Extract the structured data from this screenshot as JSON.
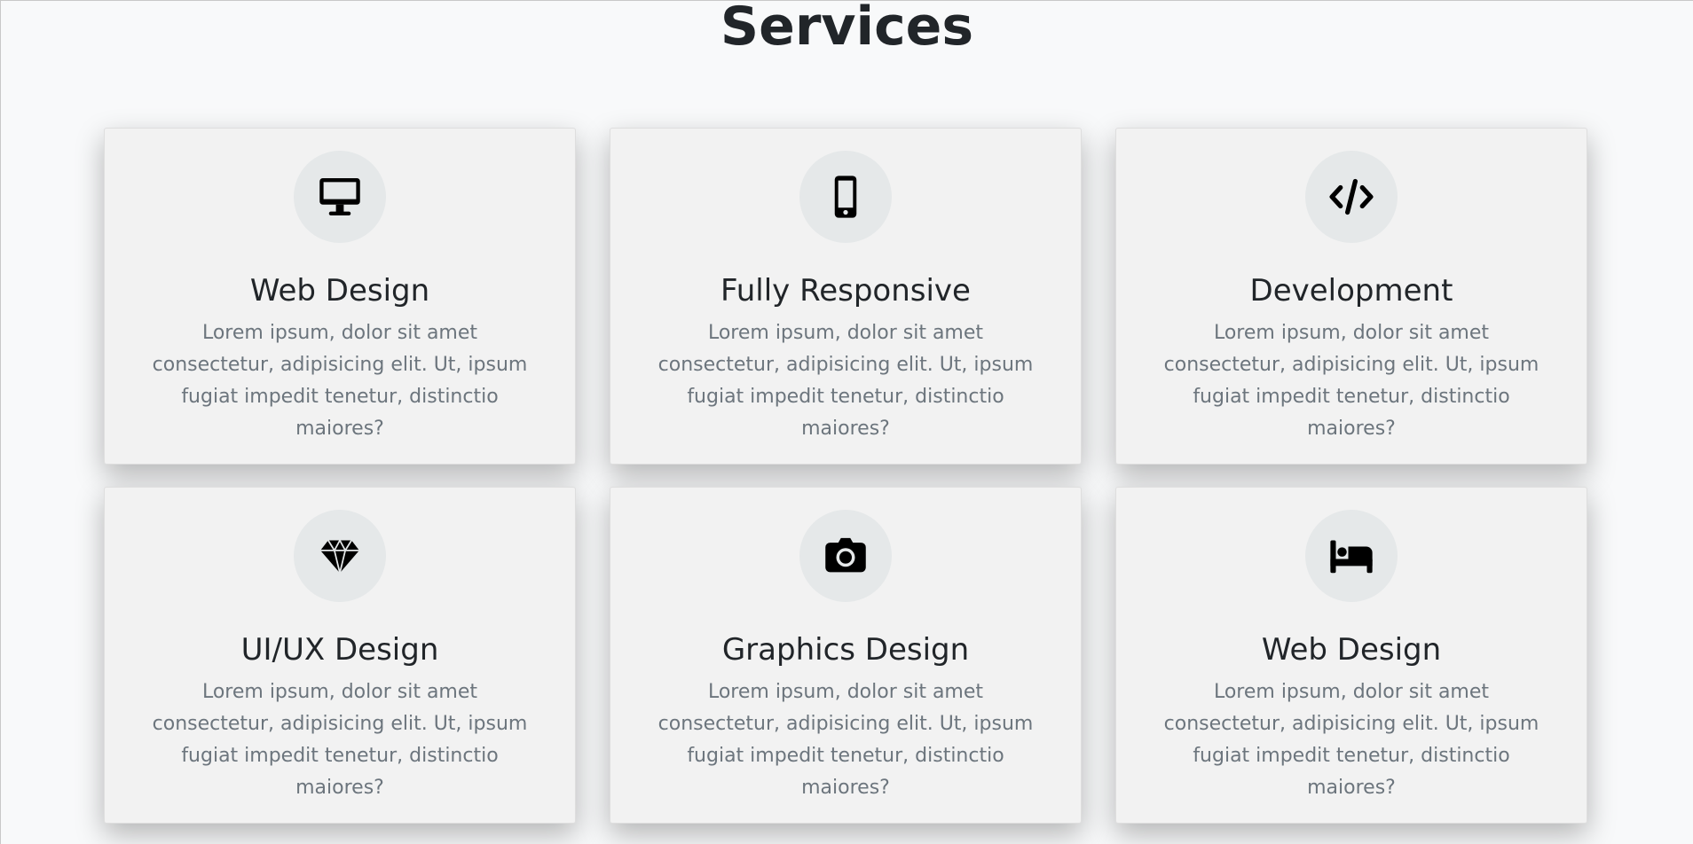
{
  "section": {
    "title": "Services"
  },
  "cards": [
    {
      "icon": "desktop-icon",
      "title": "Web Design",
      "text": "Lorem ipsum, dolor sit amet consectetur, adipisicing elit. Ut, ipsum fugiat impedit tenetur, distinctio maiores?"
    },
    {
      "icon": "mobile-icon",
      "title": "Fully Responsive",
      "text": "Lorem ipsum, dolor sit amet consectetur, adipisicing elit. Ut, ipsum fugiat impedit tenetur, distinctio maiores?"
    },
    {
      "icon": "code-icon",
      "title": "Development",
      "text": "Lorem ipsum, dolor sit amet consectetur, adipisicing elit. Ut, ipsum fugiat impedit tenetur, distinctio maiores?"
    },
    {
      "icon": "gem-icon",
      "title": "UI/UX Design",
      "text": "Lorem ipsum, dolor sit amet consectetur, adipisicing elit. Ut, ipsum fugiat impedit tenetur, distinctio maiores?"
    },
    {
      "icon": "camera-icon",
      "title": "Graphics Design",
      "text": "Lorem ipsum, dolor sit amet consectetur, adipisicing elit. Ut, ipsum fugiat impedit tenetur, distinctio maiores?"
    },
    {
      "icon": "bed-icon",
      "title": "Web Design",
      "text": "Lorem ipsum, dolor sit amet consectetur, adipisicing elit. Ut, ipsum fugiat impedit tenetur, distinctio maiores?"
    }
  ],
  "colors": {
    "page_background": "#f8f9fa",
    "card_background": "#f2f2f2",
    "icon_circle": "#e5e8e9",
    "heading_text": "#212529",
    "body_text": "#6c757d"
  }
}
